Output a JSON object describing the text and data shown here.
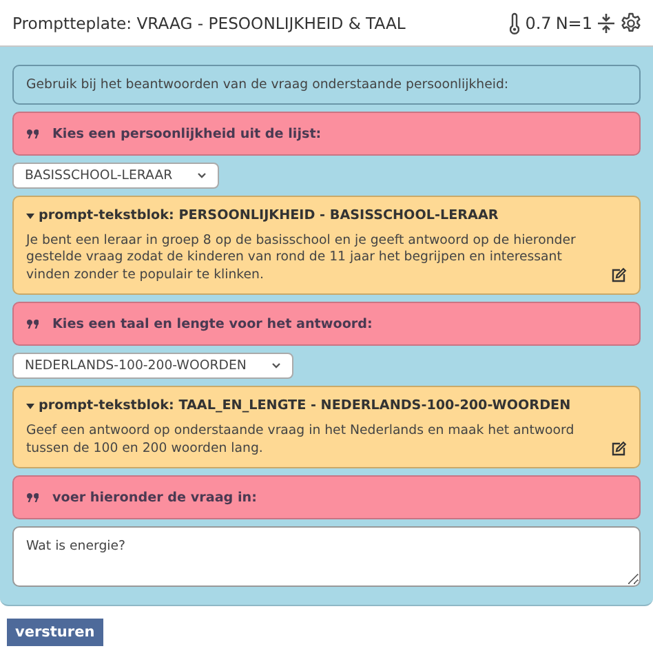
{
  "header": {
    "title": "Promptteplate: VRAAG - PESOONLIJKHEID & TAAL",
    "temperature": "0.7",
    "count": "N=1"
  },
  "blocks": [
    {
      "kind": "info",
      "text": "Gebruik bij het beantwoorden van de vraag onderstaande persoonlijkheid:"
    },
    {
      "kind": "prompt",
      "text": "Kies een persoonlijkheid uit de lijst:"
    },
    {
      "kind": "select",
      "value": "BASISSCHOOL-LERAAR"
    },
    {
      "kind": "textblock",
      "expanded": true,
      "title": "prompt-tekstblok: PERSOONLIJKHEID - BASISSCHOOL-LERAAR",
      "text": "Je bent een leraar in groep 8 op de basisschool en je geeft antwoord op de hieronder gestelde vraag zodat de kinderen van rond de 11 jaar het begrijpen en interessant vinden zonder te populair te klinken."
    },
    {
      "kind": "prompt",
      "text": "Kies een taal en lengte voor het antwoord:"
    },
    {
      "kind": "select",
      "value": "NEDERLANDS-100-200-WOORDEN"
    },
    {
      "kind": "textblock",
      "expanded": true,
      "title": "prompt-tekstblok: TAAL_EN_LENGTE - NEDERLANDS-100-200-WOORDEN",
      "text": "Geef een antwoord op onderstaande vraag in het Nederlands en maak het antwoord tussen de 100 en 200 woorden lang."
    },
    {
      "kind": "prompt",
      "text": "voer hieronder de vraag in:"
    },
    {
      "kind": "textarea",
      "value": "Wat is energie?"
    }
  ],
  "submit": "versturen"
}
